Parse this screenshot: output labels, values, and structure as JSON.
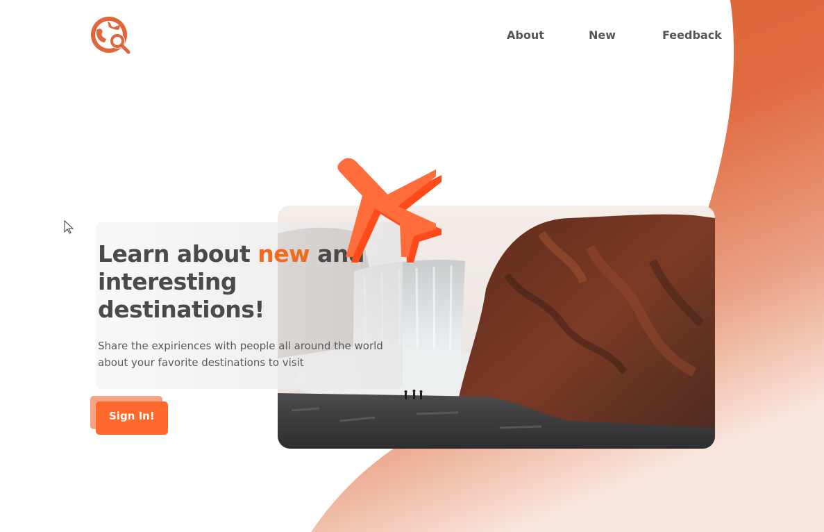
{
  "nav": {
    "items": [
      {
        "label": "About"
      },
      {
        "label": "New"
      },
      {
        "label": "Feedback"
      }
    ]
  },
  "hero": {
    "headline_before": "Learn about ",
    "headline_accent": "new",
    "headline_after": " and interesting destinations!",
    "subtext": "Share the expiriences with people all around the world about your favorite destinations to visit",
    "signin_label": "Sign In!"
  },
  "icons": {
    "logo": "globe-search-icon",
    "plane": "airplane-icon",
    "cursor": "mouse-pointer-icon"
  },
  "colors": {
    "accent": "#f26a1e",
    "button": "#ff6a2c",
    "button_shadow": "#f4a483",
    "blob": "#dd6035",
    "text_dark": "#4a4a4a",
    "nav_text": "#555555"
  }
}
